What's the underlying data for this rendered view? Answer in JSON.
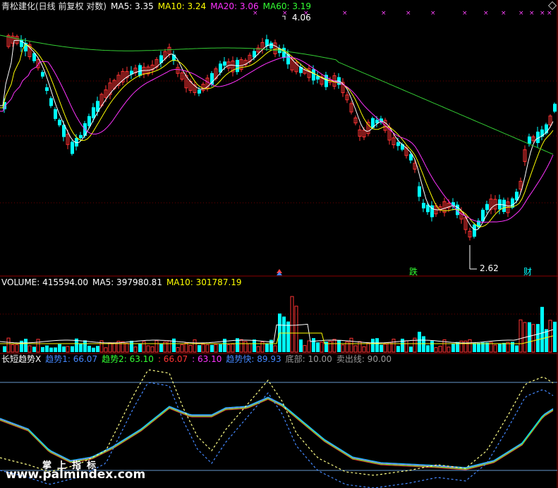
{
  "price_panel": {
    "stock_name": "青松建化(日线 前复权 对数)",
    "ma5": "MA5: 3.35",
    "ma10": "MA10: 3.24",
    "ma20": "MA20: 3.06",
    "ma60": "MA60: 3.19",
    "high_label": "4.06",
    "low_label": "2.62",
    "signal_die": "跌",
    "signal_cai": "财"
  },
  "volume_panel": {
    "volume": "VOLUME: 415594.00",
    "ma5": "MA5: 397980.81",
    "ma10": "MA10: 301787.19"
  },
  "indicator_panel": {
    "name": "长短趋势X",
    "trend1": "趋势1: 66.07",
    "trend2": "趋势2: 63.10",
    "v3": ": 66.07",
    "v4": ": 63.10",
    "fast": "趋势快: 89.93",
    "bottom": "底部: 10.00",
    "sell": "卖出线: 90.00"
  },
  "watermark": {
    "line1": "掌上指标",
    "line2": "www.palmindex.com"
  },
  "colors": {
    "up": "#ff3333",
    "down": "#00ffff",
    "ma5": "#ffffff",
    "ma10": "#ffff00",
    "ma20": "#ff33ff",
    "ma60": "#33cc33",
    "grid": "#8b0000"
  },
  "icons": [
    "up-arrow-marker-icon",
    "corner-diamond-icon"
  ]
}
